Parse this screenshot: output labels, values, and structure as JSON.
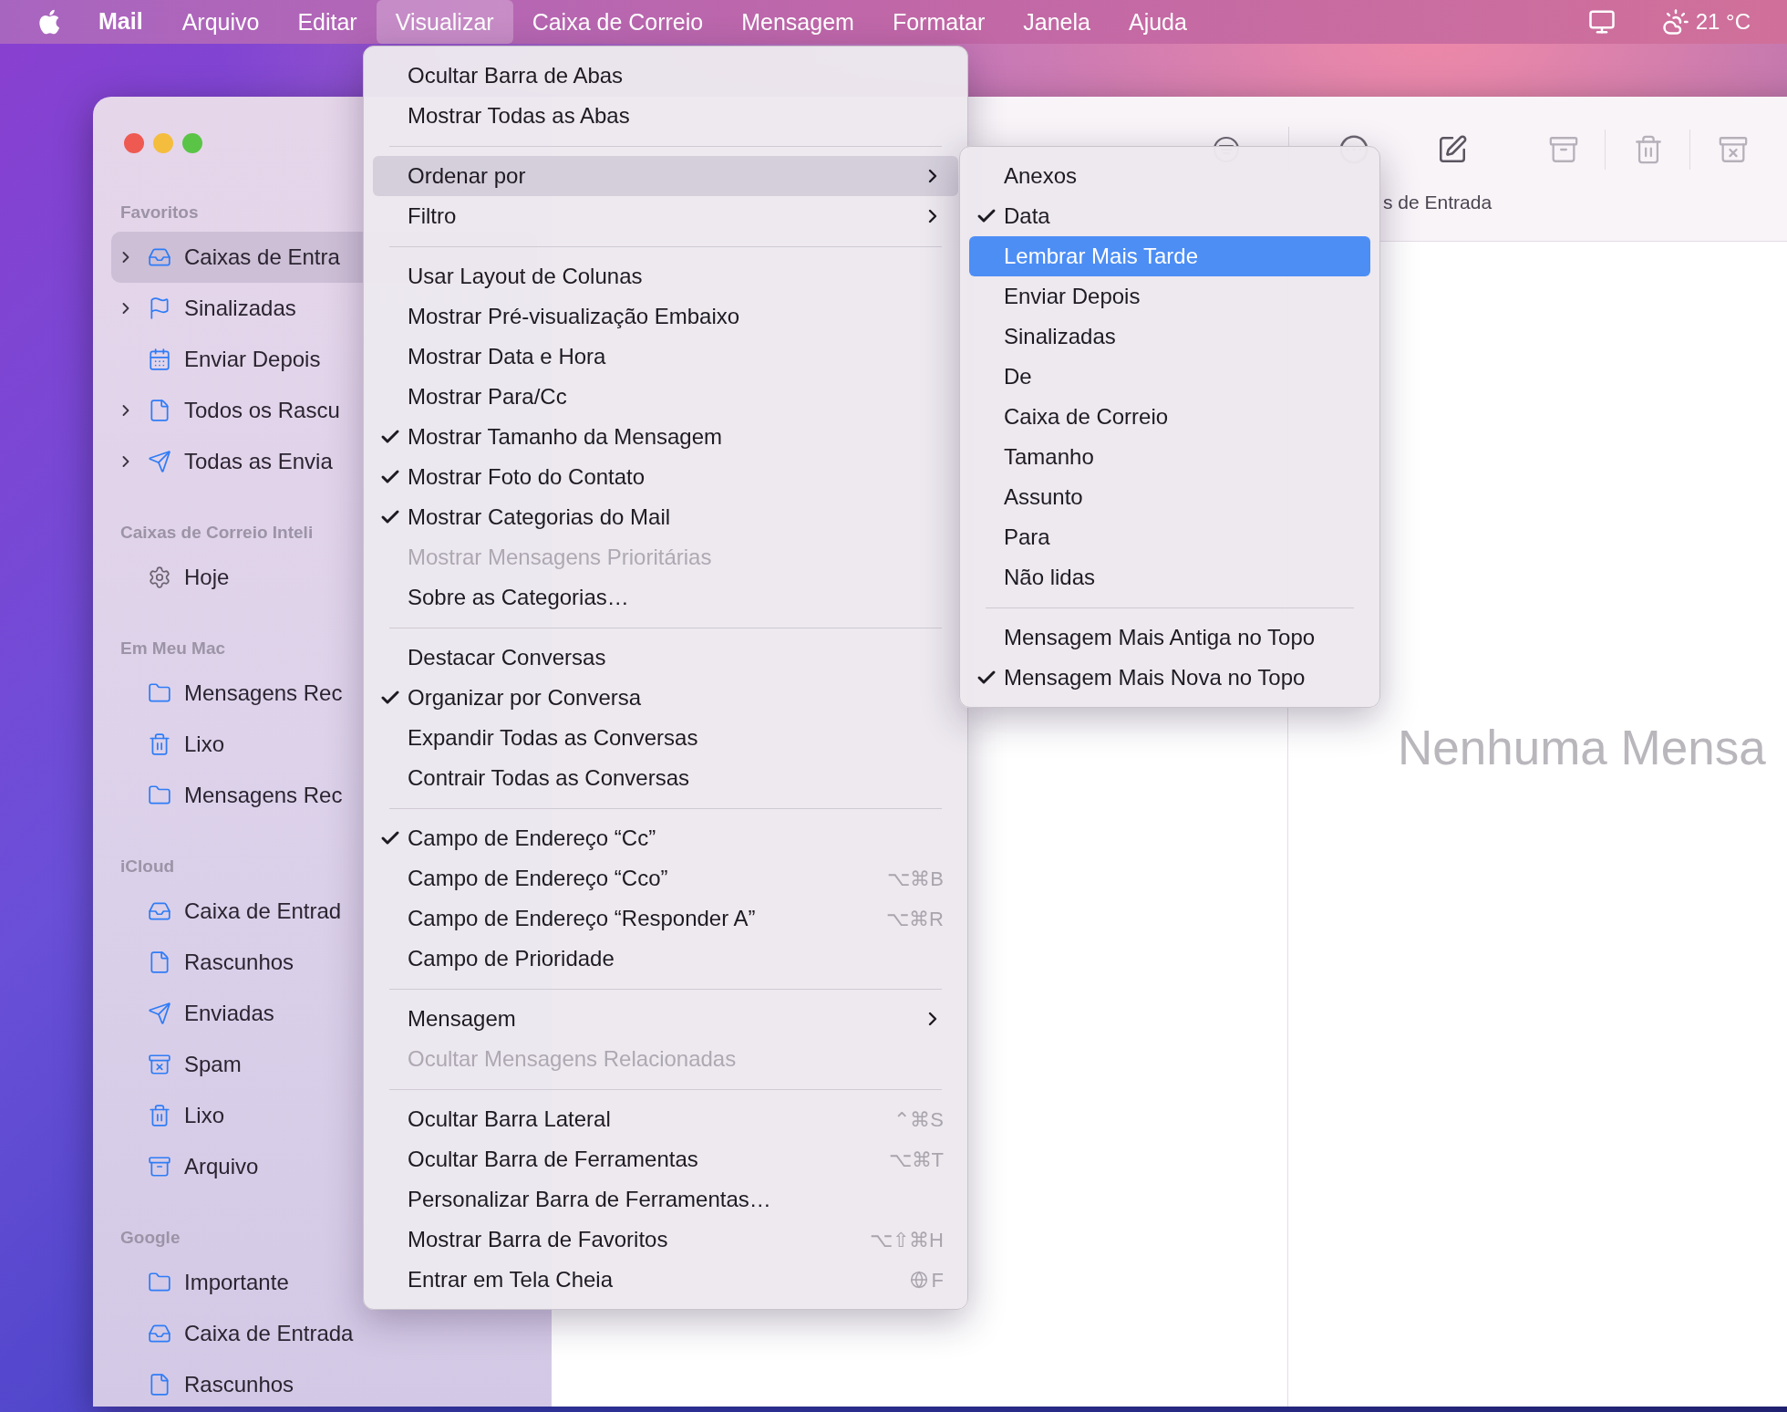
{
  "menu_bar": {
    "app_name": "Mail",
    "menus": [
      {
        "label": "Arquivo",
        "selected": false
      },
      {
        "label": "Editar",
        "selected": false
      },
      {
        "label": "Visualizar",
        "selected": true
      },
      {
        "label": "Caixa de Correio",
        "selected": false
      },
      {
        "label": "Mensagem",
        "selected": false
      },
      {
        "label": "Formatar",
        "selected": false
      },
      {
        "label": "Janela",
        "selected": false
      },
      {
        "label": "Ajuda",
        "selected": false
      }
    ],
    "temperature": "21 °C"
  },
  "window": {
    "sidebar": {
      "sections": [
        {
          "title": "Favoritos",
          "items": [
            {
              "label": "Caixas de Entra",
              "kind": "inbox",
              "expandable": true,
              "selected": true
            },
            {
              "label": "Sinalizadas",
              "kind": "flag",
              "expandable": true,
              "selected": false
            },
            {
              "label": "Enviar Depois",
              "kind": "calendar",
              "expandable": false,
              "selected": false
            },
            {
              "label": "Todos os Rascu",
              "kind": "draft",
              "expandable": true,
              "selected": false
            },
            {
              "label": "Todas as Envia",
              "kind": "sent",
              "expandable": true,
              "selected": false
            }
          ]
        },
        {
          "title": "Caixas de Correio Inteli",
          "items": [
            {
              "label": "Hoje",
              "kind": "gear",
              "selected": false
            }
          ]
        },
        {
          "title": "Em Meu Mac",
          "items": [
            {
              "label": "Mensagens Rec",
              "kind": "folder",
              "selected": false
            },
            {
              "label": "Lixo",
              "kind": "trash",
              "selected": false
            },
            {
              "label": "Mensagens Rec",
              "kind": "folder",
              "selected": false
            }
          ]
        },
        {
          "title": "iCloud",
          "items": [
            {
              "label": "Caixa de Entrad",
              "kind": "tray",
              "selected": false
            },
            {
              "label": "Rascunhos",
              "kind": "draft",
              "selected": false
            },
            {
              "label": "Enviadas",
              "kind": "sent",
              "selected": false
            },
            {
              "label": "Spam",
              "kind": "spam",
              "selected": false
            },
            {
              "label": "Lixo",
              "kind": "trash",
              "selected": false
            },
            {
              "label": "Arquivo",
              "kind": "archive",
              "selected": false
            }
          ]
        },
        {
          "title": "Google",
          "items": [
            {
              "label": "Importante",
              "kind": "folder",
              "selected": false
            },
            {
              "label": "Caixa de Entrada",
              "kind": "tray",
              "selected": false
            },
            {
              "label": "Rascunhos",
              "kind": "draft",
              "selected": false
            }
          ]
        }
      ]
    },
    "toolbar": {
      "subtitle": "s de Entrada"
    },
    "empty_message": "Nenhuma Mensa"
  },
  "view_menu": {
    "items": [
      {
        "kind": "item",
        "label": "Ocultar Barra de Abas",
        "checked": false,
        "disabled": false,
        "selected": false
      },
      {
        "kind": "item",
        "label": "Mostrar Todas as Abas",
        "checked": false,
        "disabled": false,
        "selected": false
      },
      {
        "kind": "separator"
      },
      {
        "kind": "item",
        "label": "Ordenar por",
        "checked": false,
        "disabled": false,
        "selected": true,
        "submenu": true
      },
      {
        "kind": "item",
        "label": "Filtro",
        "checked": false,
        "disabled": false,
        "selected": false,
        "submenu": true
      },
      {
        "kind": "separator"
      },
      {
        "kind": "item",
        "label": "Usar Layout de Colunas",
        "checked": false,
        "disabled": false,
        "selected": false
      },
      {
        "kind": "item",
        "label": "Mostrar Pré-visualização Embaixo",
        "checked": false,
        "disabled": false,
        "selected": false
      },
      {
        "kind": "item",
        "label": "Mostrar Data e Hora",
        "checked": false,
        "disabled": false,
        "selected": false
      },
      {
        "kind": "item",
        "label": "Mostrar Para/Cc",
        "checked": false,
        "disabled": false,
        "selected": false
      },
      {
        "kind": "item",
        "label": "Mostrar Tamanho da Mensagem",
        "checked": true,
        "disabled": false,
        "selected": false
      },
      {
        "kind": "item",
        "label": "Mostrar Foto do Contato",
        "checked": true,
        "disabled": false,
        "selected": false
      },
      {
        "kind": "item",
        "label": "Mostrar Categorias do Mail",
        "checked": true,
        "disabled": false,
        "selected": false
      },
      {
        "kind": "item",
        "label": "Mostrar Mensagens Prioritárias",
        "checked": false,
        "disabled": true,
        "selected": false
      },
      {
        "kind": "item",
        "label": "Sobre as Categorias…",
        "checked": false,
        "disabled": false,
        "selected": false
      },
      {
        "kind": "separator"
      },
      {
        "kind": "item",
        "label": "Destacar Conversas",
        "checked": false,
        "disabled": false,
        "selected": false
      },
      {
        "kind": "item",
        "label": "Organizar por Conversa",
        "checked": true,
        "disabled": false,
        "selected": false
      },
      {
        "kind": "item",
        "label": "Expandir Todas as Conversas",
        "checked": false,
        "disabled": false,
        "selected": false
      },
      {
        "kind": "item",
        "label": "Contrair Todas as Conversas",
        "checked": false,
        "disabled": false,
        "selected": false
      },
      {
        "kind": "separator"
      },
      {
        "kind": "item",
        "label": "Campo de Endereço “Cc”",
        "checked": true,
        "disabled": false,
        "selected": false
      },
      {
        "kind": "item",
        "label": "Campo de Endereço “Cco”",
        "checked": false,
        "disabled": false,
        "selected": false,
        "shortcut": "⌥⌘B"
      },
      {
        "kind": "item",
        "label": "Campo de Endereço “Responder A”",
        "checked": false,
        "disabled": false,
        "selected": false,
        "shortcut": "⌥⌘R"
      },
      {
        "kind": "item",
        "label": "Campo de Prioridade",
        "checked": false,
        "disabled": false,
        "selected": false
      },
      {
        "kind": "separator"
      },
      {
        "kind": "item",
        "label": "Mensagem",
        "checked": false,
        "disabled": false,
        "selected": false,
        "submenu": true
      },
      {
        "kind": "item",
        "label": "Ocultar Mensagens Relacionadas",
        "checked": false,
        "disabled": true,
        "selected": false
      },
      {
        "kind": "separator"
      },
      {
        "kind": "item",
        "label": "Ocultar Barra Lateral",
        "checked": false,
        "disabled": false,
        "selected": false,
        "shortcut": "⌃⌘S"
      },
      {
        "kind": "item",
        "label": "Ocultar Barra de Ferramentas",
        "checked": false,
        "disabled": false,
        "selected": false,
        "shortcut": "⌥⌘T"
      },
      {
        "kind": "item",
        "label": "Personalizar Barra de Ferramentas…",
        "checked": false,
        "disabled": false,
        "selected": false
      },
      {
        "kind": "item",
        "label": "Mostrar Barra de Favoritos",
        "checked": false,
        "disabled": false,
        "selected": false,
        "shortcut": "⌥⇧⌘H"
      },
      {
        "kind": "item",
        "label": "Entrar em Tela Cheia",
        "checked": false,
        "disabled": false,
        "selected": false,
        "shortcut": "F",
        "globe": true
      }
    ]
  },
  "sort_submenu": {
    "items": [
      {
        "kind": "item",
        "label": "Anexos",
        "checked": false,
        "selected": false
      },
      {
        "kind": "item",
        "label": "Data",
        "checked": true,
        "selected": false
      },
      {
        "kind": "item",
        "label": "Lembrar Mais Tarde",
        "checked": false,
        "selected": true
      },
      {
        "kind": "item",
        "label": "Enviar Depois",
        "checked": false,
        "selected": false
      },
      {
        "kind": "item",
        "label": "Sinalizadas",
        "checked": false,
        "selected": false
      },
      {
        "kind": "item",
        "label": "De",
        "checked": false,
        "selected": false
      },
      {
        "kind": "item",
        "label": "Caixa de Correio",
        "checked": false,
        "selected": false
      },
      {
        "kind": "item",
        "label": "Tamanho",
        "checked": false,
        "selected": false
      },
      {
        "kind": "item",
        "label": "Assunto",
        "checked": false,
        "selected": false
      },
      {
        "kind": "item",
        "label": "Para",
        "checked": false,
        "selected": false
      },
      {
        "kind": "item",
        "label": "Não lidas",
        "checked": false,
        "selected": false
      },
      {
        "kind": "separator"
      },
      {
        "kind": "item",
        "label": "Mensagem Mais Antiga no Topo",
        "checked": false,
        "selected": false
      },
      {
        "kind": "item",
        "label": "Mensagem Mais Nova no Topo",
        "checked": true,
        "selected": false
      }
    ]
  }
}
